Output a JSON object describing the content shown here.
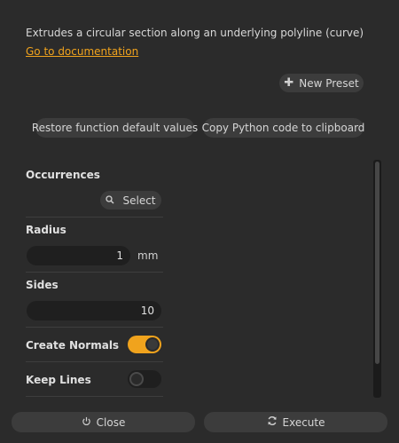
{
  "header": {
    "description": "Extrudes a circular section along an underlying polyline (curve)",
    "doc_link": "Go to documentation"
  },
  "toolbar": {
    "new_preset_icon": "plus-icon",
    "new_preset_label": "New Preset",
    "restore_label": "Restore function default values",
    "copy_python_label": "Copy Python code to clipboard"
  },
  "params": {
    "occurrences": {
      "label": "Occurrences",
      "select_label": "Select",
      "select_icon": "search-icon"
    },
    "radius": {
      "label": "Radius",
      "value": "1",
      "unit": "mm"
    },
    "sides": {
      "label": "Sides",
      "value": "10"
    },
    "create_normals": {
      "label": "Create Normals",
      "on": true
    },
    "keep_lines": {
      "label": "Keep Lines",
      "on": false
    }
  },
  "footer": {
    "close_label": "Close",
    "close_icon": "power-icon",
    "execute_label": "Execute",
    "execute_icon": "refresh-icon"
  },
  "colors": {
    "accent": "#f0a31d",
    "background": "#2b2b2b",
    "button": "#3c3c3c",
    "field": "#1f1f1f"
  }
}
